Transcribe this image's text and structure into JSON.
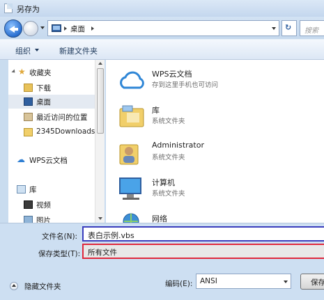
{
  "window": {
    "title": "另存为"
  },
  "address": {
    "path": "桌面",
    "search_placeholder": "搜索"
  },
  "toolbar": {
    "organize_label": "组织",
    "new_folder_label": "新建文件夹"
  },
  "nav": {
    "items": [
      {
        "label": "收藏夹",
        "icon": "star-icon"
      },
      {
        "label": "下载",
        "icon": "downloads-folder-icon"
      },
      {
        "label": "桌面",
        "icon": "desktop-icon",
        "selected": true
      },
      {
        "label": "最近访问的位置",
        "icon": "recent-places-icon"
      },
      {
        "label": "2345Downloads",
        "icon": "folder-icon"
      },
      {
        "label": "WPS云文档",
        "icon": "cloud-icon"
      },
      {
        "label": "库",
        "icon": "library-icon"
      },
      {
        "label": "视频",
        "icon": "video-icon"
      },
      {
        "label": "图片",
        "icon": "pictures-icon"
      }
    ]
  },
  "files": [
    {
      "name": "WPS云文档",
      "desc": "存到这里手机也可访问",
      "icon": "cloud-icon"
    },
    {
      "name": "库",
      "desc": "系统文件夹",
      "icon": "library-icon"
    },
    {
      "name": "Administrator",
      "desc": "系统文件夹",
      "icon": "user-folder-icon"
    },
    {
      "name": "计算机",
      "desc": "系统文件夹",
      "icon": "computer-icon"
    },
    {
      "name": "网络",
      "desc": "",
      "icon": "network-icon"
    }
  ],
  "form": {
    "filename_label": "文件名(N):",
    "filename_value": "表白示例.vbs",
    "filetype_label": "保存类型(T):",
    "filetype_value": "所有文件",
    "hide_folders_label": "隐藏文件夹",
    "encoding_label": "编码(E):",
    "encoding_value": "ANSI",
    "save_label": "保存"
  },
  "colors": {
    "filename_border": "#3a3dbd",
    "filetype_border": "#e0283c"
  }
}
